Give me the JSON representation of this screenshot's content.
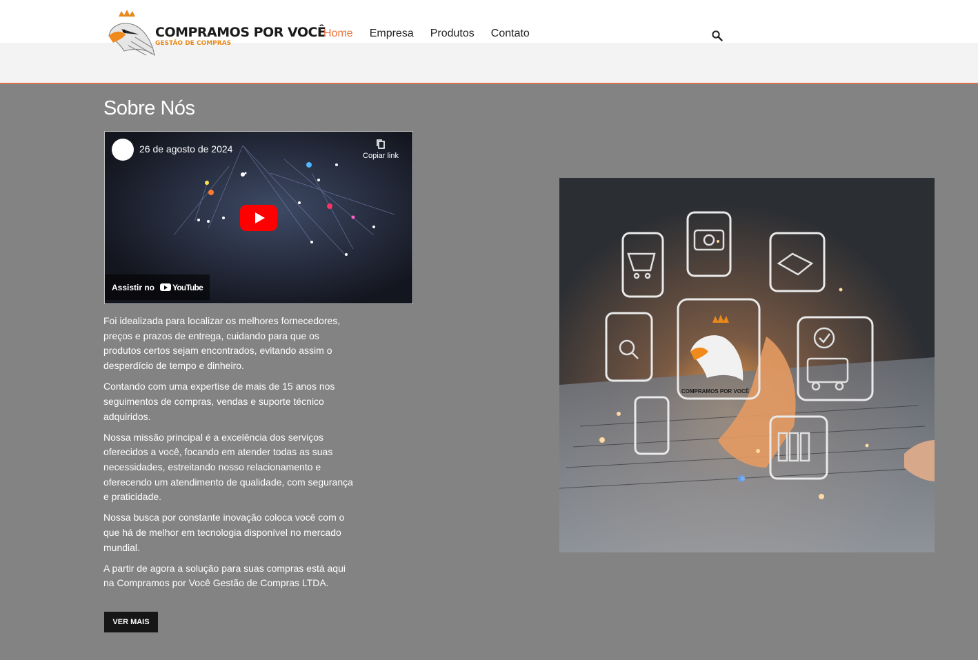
{
  "brand": {
    "name": "COMPRAMOS POR VOCÊ",
    "tagline": "GESTÃO DE COMPRAS"
  },
  "nav": [
    {
      "label": "Home",
      "active": true
    },
    {
      "label": "Empresa"
    },
    {
      "label": "Produtos"
    },
    {
      "label": "Contato"
    }
  ],
  "section_title": "Sobre Nós",
  "video": {
    "date": "26 de agosto de 2024",
    "copy_link": "Copiar link",
    "watch_on": "Assistir no",
    "platform": "YouTube"
  },
  "paragraphs": [
    "Foi idealizada para localizar os melhores fornecedores, preços e prazos de entrega, cuidando para que os produtos certos sejam encontrados, evitando assim o desperdício de tempo e dinheiro.",
    "Contando com uma expertise de mais de 15 anos nos seguimentos de compras, vendas e suporte técnico adquiridos.",
    "Nossa missão principal é a excelência dos serviços oferecidos a você, focando em atender todas as suas necessidades, estreitando nosso relacionamento e oferecendo um atendimento de qualidade, com segurança e praticidade.",
    "Nossa busca por constante inovação coloca você com o que há de melhor em tecnologia disponível no mercado mundial.",
    "A partir de agora a solução para suas compras está aqui na Compramos por Você Gestão de Compras LTDA."
  ],
  "cta_label": "VER MAIS",
  "hero_badge": "COMPRAMOS POR VOCÊ",
  "colors": {
    "accent": "#e8733a",
    "brand_orange": "#e8891c",
    "background": "#838383"
  }
}
